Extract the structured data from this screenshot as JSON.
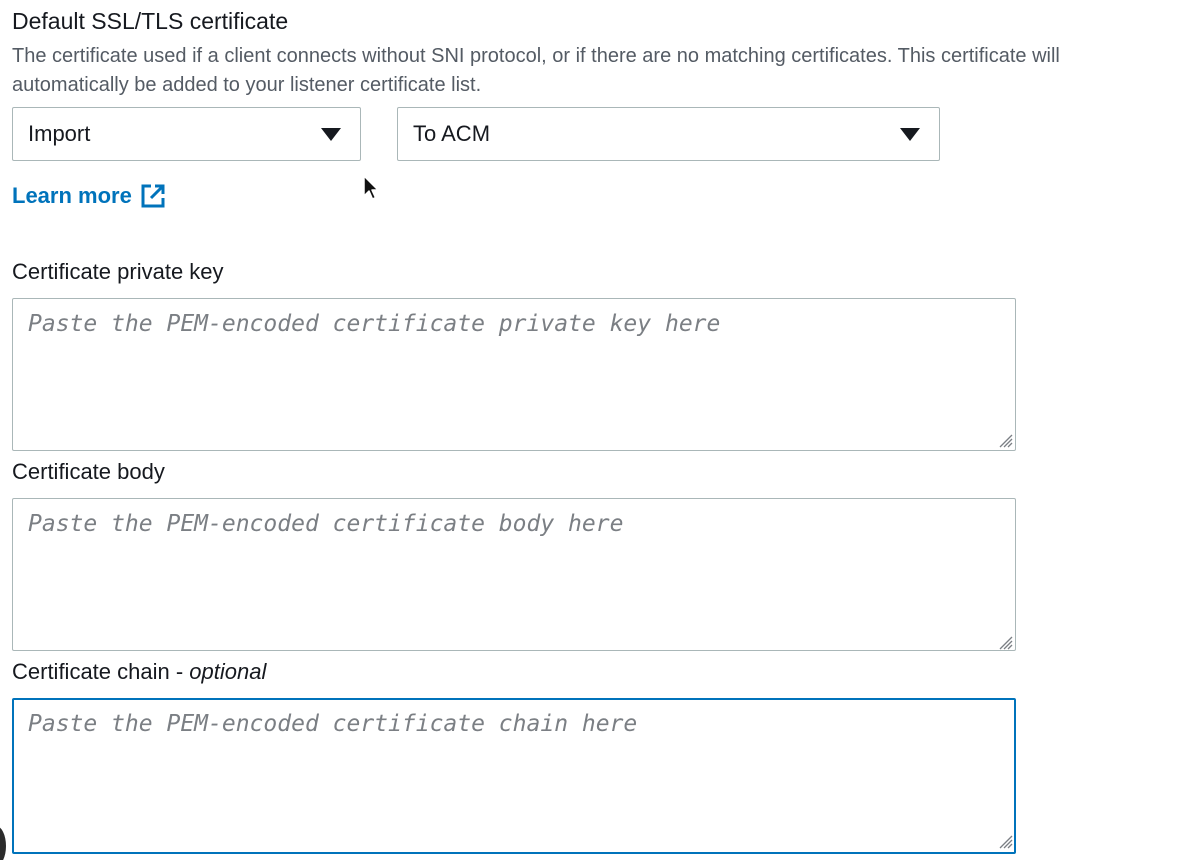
{
  "section": {
    "title": "Default SSL/TLS certificate",
    "description": "The certificate used if a client connects without SNI protocol, or if there are no matching certificates. This certificate will automatically be added to your listener certificate list."
  },
  "selects": {
    "source": {
      "value": "Import"
    },
    "destination": {
      "value": "To ACM"
    }
  },
  "learn_more": {
    "label": "Learn more",
    "icon": "external-link-icon"
  },
  "fields": {
    "private_key": {
      "label": "Certificate private key",
      "placeholder": "Paste the PEM-encoded certificate private key here",
      "value": ""
    },
    "body": {
      "label": "Certificate body",
      "placeholder": "Paste the PEM-encoded certificate body here",
      "value": ""
    },
    "chain": {
      "label": "Certificate chain - ",
      "label_suffix": "optional",
      "placeholder": "Paste the PEM-encoded certificate chain here",
      "value": "",
      "focused": true
    }
  },
  "colors": {
    "link": "#0073bb",
    "focus_border": "#0073bb",
    "border": "#aab7b8",
    "text": "#16191f",
    "secondary_text": "#545b64",
    "placeholder": "#7b7f84"
  }
}
